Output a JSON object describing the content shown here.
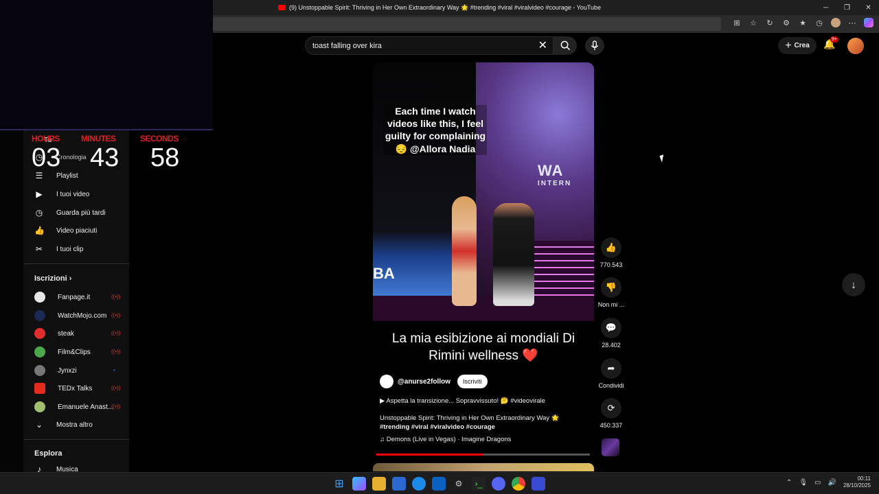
{
  "window": {
    "title": "(9) Unstoppable Spirit: Thriving in Her Own Extraordinary Way 🌟 #trending #viral #viralvideo #courage - YouTube",
    "controls": [
      "─",
      "❐",
      "✕"
    ]
  },
  "timer": {
    "labels": {
      "hours": "HOURS",
      "minutes": "MINUTES",
      "seconds": "SECONDS"
    },
    "values": {
      "hours": "03",
      "minutes": "43",
      "seconds": "58"
    }
  },
  "header": {
    "search_query": "toast falling over kira",
    "create_label": "Crea",
    "notifications_badge": "9+"
  },
  "sidebar": {
    "partial_top": [
      "Tu",
      "Cronologia"
    ],
    "you_items": [
      {
        "label": "Playlist",
        "icon": "playlist-icon",
        "glyph": "☰"
      },
      {
        "label": "I tuoi video",
        "icon": "video-icon",
        "glyph": "▶"
      },
      {
        "label": "Guarda più tardi",
        "icon": "clock-icon",
        "glyph": "◷"
      },
      {
        "label": "Video piaciuti",
        "icon": "thumbs-up-icon",
        "glyph": "👍"
      },
      {
        "label": "I tuoi clip",
        "icon": "scissors-icon",
        "glyph": "✂"
      }
    ],
    "subscriptions_title": "Iscrizioni",
    "subscriptions": [
      {
        "label": "Fanpage.it",
        "color": "#e8e8e8",
        "live": true
      },
      {
        "label": "WatchMojo.com",
        "color": "#1b2a55",
        "live": true
      },
      {
        "label": "steak",
        "color": "#e02d2d",
        "live": true
      },
      {
        "label": "Film&Clips",
        "color": "#4aa84a",
        "live": true
      },
      {
        "label": "Jynxzi",
        "color": "#777777",
        "live": false
      },
      {
        "label": "TEDx Talks",
        "color": "#e62b1e",
        "live": true
      },
      {
        "label": "Emanuele Anast...",
        "color": "#a0c070",
        "live": true
      }
    ],
    "show_more": "Mostra altro",
    "explore_title": "Esplora",
    "explore_items": [
      "Musica"
    ]
  },
  "short": {
    "overlay_text": "Each time I watch videos like this, I feel guilty for complaining😔 @Allora Nadia",
    "stage_logo": "WA",
    "stage_logo_sub": "INTERN",
    "banner_text": "BA",
    "caption": "La mia esibizione ai mondiali Di Rimini wellness ❤️",
    "channel": "@anurse2follow",
    "subscribe_label": "Iscriviti",
    "line_a": "▶  Aspetta la transizione... Sopravvissuto! 🤔 #videovirale",
    "description_plain": "Unstoppable Spirit: Thriving in Her Own Extraordinary Way 🌟 ",
    "description_tags": "#trending #viral #viralvideo #courage",
    "music": "♫ Demons (Live in Vegas) · Imagine Dragons",
    "progress_fraction": 0.5
  },
  "actions": {
    "likes": "770.543",
    "dislike_label": "Non mi ...",
    "comments": "28.402",
    "share_label": "Condividi",
    "remix_count": "450.337"
  },
  "taskbar": {
    "time": "00:11",
    "date": "28/10/2025"
  }
}
